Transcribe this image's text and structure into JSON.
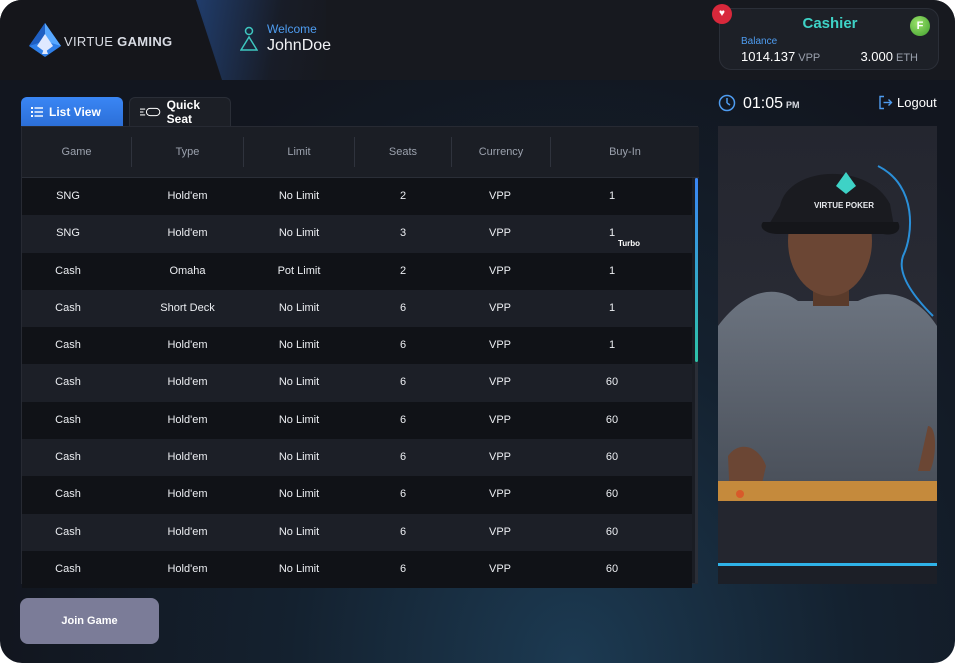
{
  "brand": {
    "name_light": "VIRTUE",
    "name_bold": "GAMING"
  },
  "user": {
    "welcome": "Welcome",
    "username": "JohnDoe"
  },
  "cashier": {
    "title": "Cashier",
    "balance_label": "Balance",
    "vpp_amount": "1014.137",
    "vpp_unit": "VPP",
    "eth_amount": "3.000",
    "eth_unit": "ETH",
    "badge": "F"
  },
  "tabs": {
    "list_view": "List View",
    "quick_seat": "Quick Seat"
  },
  "table": {
    "headers": [
      "Game",
      "Type",
      "Limit",
      "Seats",
      "Currency",
      "Buy-In"
    ],
    "rows": [
      [
        "SNG",
        "Hold'em",
        "No Limit",
        "2",
        "VPP",
        "1"
      ],
      [
        "SNG",
        "Hold'em",
        "No Limit",
        "3",
        "VPP",
        "1"
      ],
      [
        "Cash",
        "Omaha",
        "Pot Limit",
        "2",
        "VPP",
        "1"
      ],
      [
        "Cash",
        "Short Deck",
        "No Limit",
        "6",
        "VPP",
        "1"
      ],
      [
        "Cash",
        "Hold'em",
        "No Limit",
        "6",
        "VPP",
        "1"
      ],
      [
        "Cash",
        "Hold'em",
        "No Limit",
        "6",
        "VPP",
        "60"
      ],
      [
        "Cash",
        "Hold'em",
        "No Limit",
        "6",
        "VPP",
        "60"
      ],
      [
        "Cash",
        "Hold'em",
        "No Limit",
        "6",
        "VPP",
        "60"
      ],
      [
        "Cash",
        "Hold'em",
        "No Limit",
        "6",
        "VPP",
        "60"
      ],
      [
        "Cash",
        "Hold'em",
        "No Limit",
        "6",
        "VPP",
        "60"
      ],
      [
        "Cash",
        "Hold'em",
        "No Limit",
        "6",
        "VPP",
        "60"
      ]
    ],
    "turbo_tag": "Turbo"
  },
  "join_button": "Join Game",
  "clock": {
    "time": "01:05",
    "period": "PM"
  },
  "logout": "Logout",
  "promo": {
    "cap_text": "VIRTUE POKER"
  },
  "colors": {
    "accent_blue": "#3a86f5",
    "teal": "#3ed2c6",
    "join_button": "#7b7c98"
  },
  "icons": [
    "virtue-logo-icon",
    "user-icon",
    "list-icon",
    "quick-seat-icon",
    "clock-icon",
    "logout-icon",
    "notification-badge-icon"
  ]
}
